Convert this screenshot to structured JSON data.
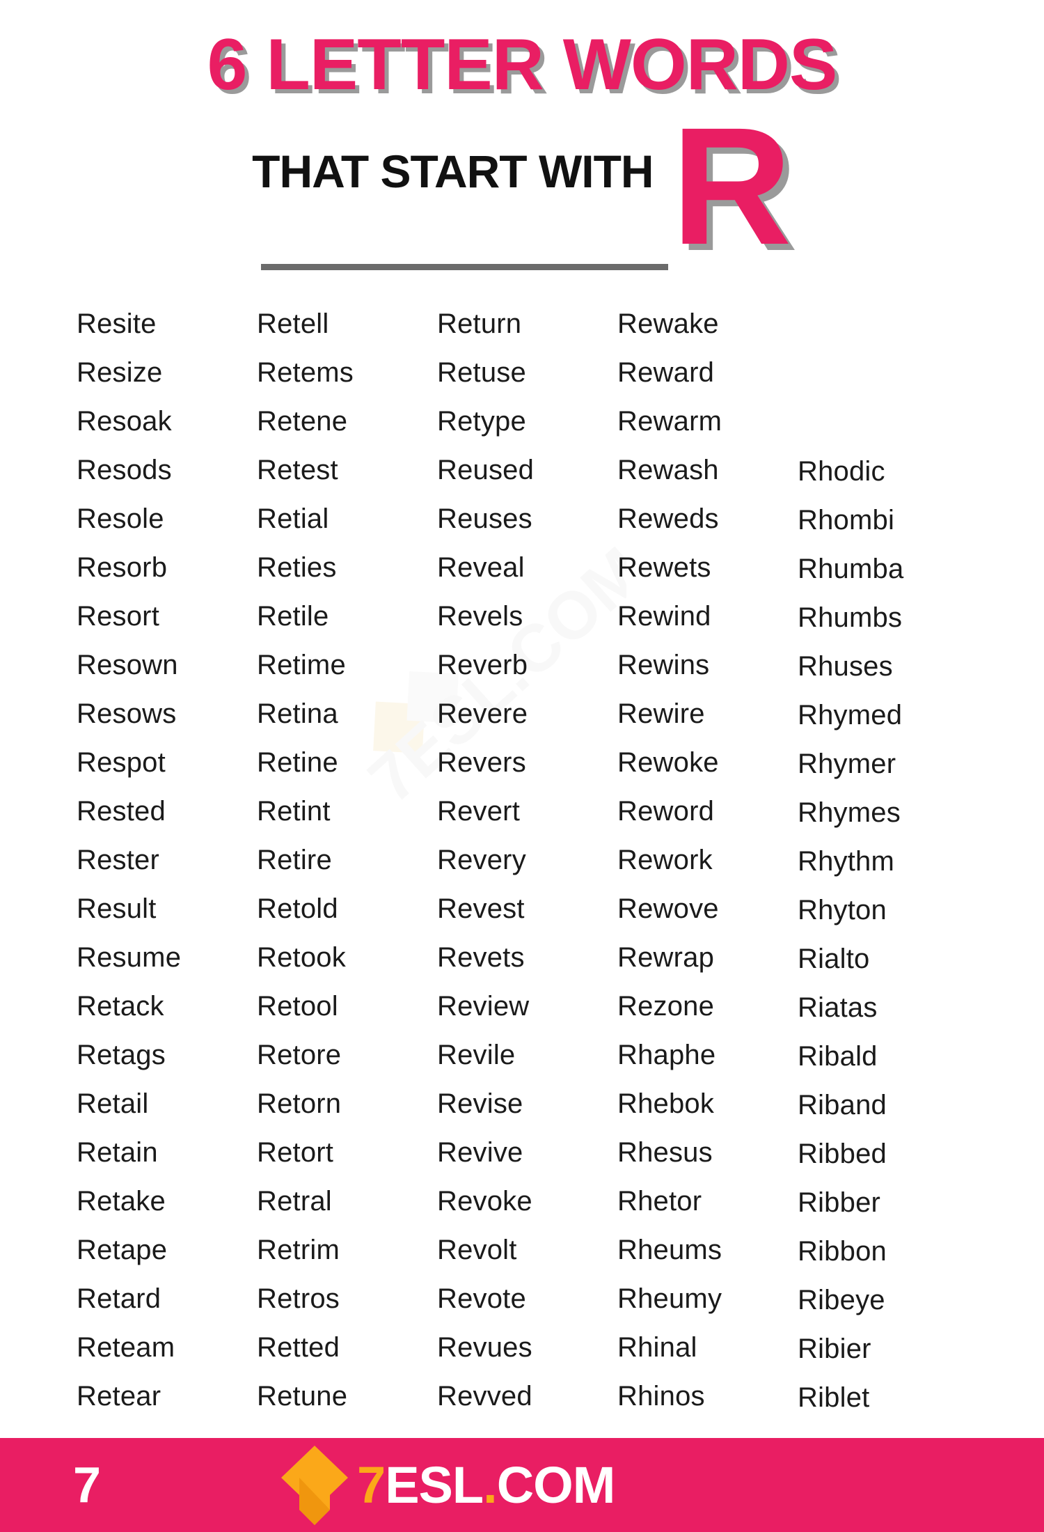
{
  "header": {
    "title_main": "6 LETTER WORDS",
    "title_sub": "THAT START WITH",
    "big_letter": "R",
    "accent_color": "#E91E63",
    "shadow_color": "#9A9A9A",
    "text_color": "#111111"
  },
  "watermark": {
    "text": "7ESL.COM"
  },
  "columns": [
    {
      "id": "column-1",
      "words": [
        "Resite",
        "Resize",
        "Resoak",
        "Resods",
        "Resole",
        "Resorb",
        "Resort",
        "Resown",
        "Resows",
        "Respot",
        "Rested",
        "Rester",
        "Result",
        "Resume",
        "Retack",
        "Retags",
        "Retail",
        "Retain",
        "Retake",
        "Retape",
        "Retard",
        "Reteam",
        "Retear"
      ]
    },
    {
      "id": "column-2",
      "words": [
        "Retell",
        "Retems",
        "Retene",
        "Retest",
        "Retial",
        "Reties",
        "Retile",
        "Retime",
        "Retina",
        "Retine",
        "Retint",
        "Retire",
        "Retold",
        "Retook",
        "Retool",
        "Retore",
        "Retorn",
        "Retort",
        "Retral",
        "Retrim",
        "Retros",
        "Retted",
        "Retune"
      ]
    },
    {
      "id": "column-3",
      "words": [
        "Return",
        "Retuse",
        "Retype",
        "Reused",
        "Reuses",
        "Reveal",
        "Revels",
        "Reverb",
        "Revere",
        "Revers",
        "Revert",
        "Revery",
        "Revest",
        "Revets",
        "Review",
        "Revile",
        "Revise",
        "Revive",
        "Revoke",
        "Revolt",
        "Revote",
        "Revues",
        "Revved"
      ]
    },
    {
      "id": "column-4",
      "words": [
        "Rewake",
        "Reward",
        "Rewarm",
        "Rewash",
        "Reweds",
        "Rewets",
        "Rewind",
        "Rewins",
        "Rewire",
        "Rewoke",
        "Reword",
        "Rework",
        "Rewove",
        "Rewrap",
        "Rezone",
        "Rhaphe",
        "Rhebok",
        "Rhesus",
        "Rhetor",
        "Rheums",
        "Rheumy",
        "Rhinal",
        "Rhinos"
      ]
    },
    {
      "id": "column-5",
      "words": [
        "Rhodic",
        "Rhombi",
        "Rhumba",
        "Rhumbs",
        "Rhuses",
        "Rhymed",
        "Rhymer",
        "Rhymes",
        "Rhythm",
        "Rhyton",
        "Rialto",
        "Riatas",
        "Ribald",
        "Riband",
        "Ribbed",
        "Ribber",
        "Ribbon",
        "Ribeye",
        "Ribier",
        "Riblet"
      ]
    }
  ],
  "footer": {
    "page_number": "7",
    "logo_seven": "7",
    "logo_esl": "ESL",
    "logo_dot": ".",
    "logo_com": "COM",
    "background_color": "#E91E63",
    "logo_orange": "#FBA819"
  }
}
